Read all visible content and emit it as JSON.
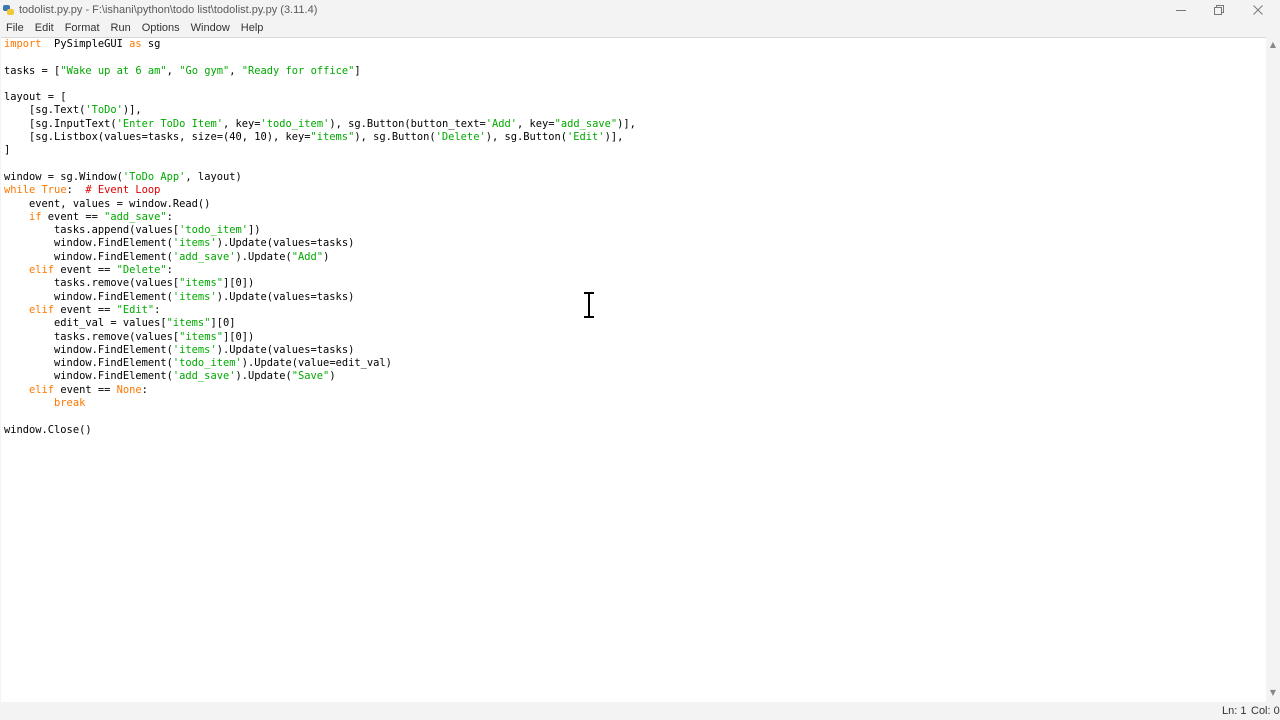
{
  "window": {
    "title": "todolist.py.py - F:\\ishani\\python\\todo list\\todolist.py.py (3.11.4)"
  },
  "menu": [
    "File",
    "Edit",
    "Format",
    "Run",
    "Options",
    "Window",
    "Help"
  ],
  "editor": {
    "lines": [
      [
        [
          "kw",
          "import"
        ],
        [
          "",
          "  PySimpleGUI "
        ],
        [
          "kw",
          "as"
        ],
        [
          "",
          " sg"
        ]
      ],
      [],
      [
        [
          "",
          "tasks = ["
        ],
        [
          "st",
          "\"Wake up at 6 am\""
        ],
        [
          "",
          ", "
        ],
        [
          "st",
          "\"Go gym\""
        ],
        [
          "",
          ", "
        ],
        [
          "st",
          "\"Ready for office\""
        ],
        [
          "",
          "]"
        ]
      ],
      [],
      [
        [
          "",
          "layout = ["
        ]
      ],
      [
        [
          "",
          "    [sg.Text("
        ],
        [
          "st",
          "'ToDo'"
        ],
        [
          "",
          ")],"
        ]
      ],
      [
        [
          "",
          "    [sg.InputText("
        ],
        [
          "st",
          "'Enter ToDo Item'"
        ],
        [
          "",
          ", key="
        ],
        [
          "st",
          "'todo_item'"
        ],
        [
          "",
          "), sg.Button(button_text="
        ],
        [
          "st",
          "'Add'"
        ],
        [
          "",
          ", key="
        ],
        [
          "st",
          "\"add_save\""
        ],
        [
          "",
          ")],"
        ]
      ],
      [
        [
          "",
          "    [sg.Listbox(values=tasks, size=(40, 10), key="
        ],
        [
          "st",
          "\"items\""
        ],
        [
          "",
          "), sg.Button("
        ],
        [
          "st",
          "'Delete'"
        ],
        [
          "",
          "), sg.Button("
        ],
        [
          "st",
          "'Edit'"
        ],
        [
          "",
          ")],"
        ]
      ],
      [
        [
          "",
          "]"
        ]
      ],
      [],
      [
        [
          "",
          "window = sg.Window("
        ],
        [
          "st",
          "'ToDo App'"
        ],
        [
          "",
          ", layout)"
        ]
      ],
      [
        [
          "kw",
          "while"
        ],
        [
          "",
          " "
        ],
        [
          "kw",
          "True"
        ],
        [
          "",
          ":  "
        ],
        [
          "cm",
          "# Event Loop"
        ]
      ],
      [
        [
          "",
          "    event, values = window.Read()"
        ]
      ],
      [
        [
          "",
          "    "
        ],
        [
          "kw",
          "if"
        ],
        [
          "",
          " event == "
        ],
        [
          "st",
          "\"add_save\""
        ],
        [
          "",
          ":"
        ]
      ],
      [
        [
          "",
          "        tasks.append(values["
        ],
        [
          "st",
          "'todo_item'"
        ],
        [
          "",
          "])"
        ]
      ],
      [
        [
          "",
          "        window.FindElement("
        ],
        [
          "st",
          "'items'"
        ],
        [
          "",
          ").Update(values=tasks)"
        ]
      ],
      [
        [
          "",
          "        window.FindElement("
        ],
        [
          "st",
          "'add_save'"
        ],
        [
          "",
          ").Update("
        ],
        [
          "st",
          "\"Add\""
        ],
        [
          "",
          ")"
        ]
      ],
      [
        [
          "",
          "    "
        ],
        [
          "kw",
          "elif"
        ],
        [
          "",
          " event == "
        ],
        [
          "st",
          "\"Delete\""
        ],
        [
          "",
          ":"
        ]
      ],
      [
        [
          "",
          "        tasks.remove(values["
        ],
        [
          "st",
          "\"items\""
        ],
        [
          "",
          "][0])"
        ]
      ],
      [
        [
          "",
          "        window.FindElement("
        ],
        [
          "st",
          "'items'"
        ],
        [
          "",
          ").Update(values=tasks)"
        ]
      ],
      [
        [
          "",
          "    "
        ],
        [
          "kw",
          "elif"
        ],
        [
          "",
          " event == "
        ],
        [
          "st",
          "\"Edit\""
        ],
        [
          "",
          ":"
        ]
      ],
      [
        [
          "",
          "        edit_val = values["
        ],
        [
          "st",
          "\"items\""
        ],
        [
          "",
          "][0]"
        ]
      ],
      [
        [
          "",
          "        tasks.remove(values["
        ],
        [
          "st",
          "\"items\""
        ],
        [
          "",
          "][0])"
        ]
      ],
      [
        [
          "",
          "        window.FindElement("
        ],
        [
          "st",
          "'items'"
        ],
        [
          "",
          ").Update(values=tasks)"
        ]
      ],
      [
        [
          "",
          "        window.FindElement("
        ],
        [
          "st",
          "'todo_item'"
        ],
        [
          "",
          ").Update(value=edit_val)"
        ]
      ],
      [
        [
          "",
          "        window.FindElement("
        ],
        [
          "st",
          "'add_save'"
        ],
        [
          "",
          ").Update("
        ],
        [
          "st",
          "\"Save\""
        ],
        [
          "",
          ")"
        ]
      ],
      [
        [
          "",
          "    "
        ],
        [
          "kw",
          "elif"
        ],
        [
          "",
          " event == "
        ],
        [
          "kw",
          "None"
        ],
        [
          "",
          ":"
        ]
      ],
      [
        [
          "",
          "        "
        ],
        [
          "kw",
          "break"
        ]
      ],
      [],
      [
        [
          "",
          "window.Close()"
        ]
      ]
    ]
  },
  "status": {
    "line": "Ln: 1",
    "col": "Col: 0"
  },
  "colors": {
    "keyword": "#ff7700",
    "string": "#00aa00",
    "comment": "#dd0000"
  },
  "icons": [
    "python-idle-icon",
    "minimize-icon",
    "restore-icon",
    "close-icon",
    "text-cursor-icon"
  ]
}
